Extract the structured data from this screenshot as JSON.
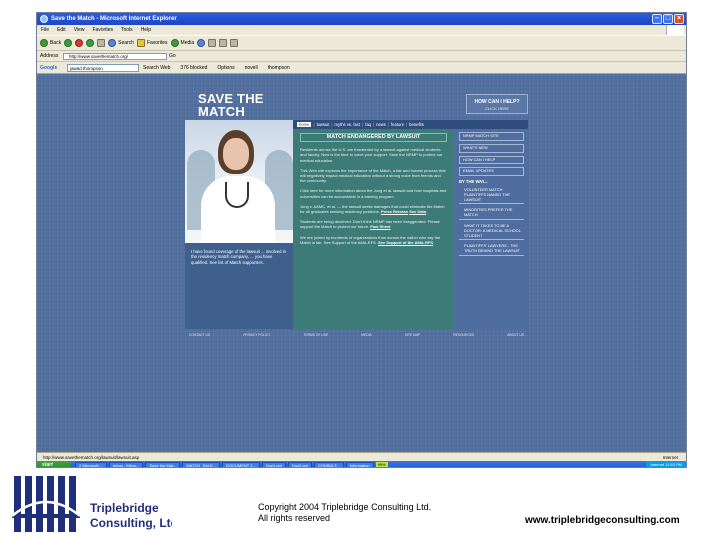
{
  "browser": {
    "window_title": "Save the Match - Microsoft Internet Explorer",
    "menu": [
      "File",
      "Edit",
      "View",
      "Favorites",
      "Tools",
      "Help"
    ],
    "toolbar": {
      "back": "Back",
      "search": "Search",
      "favorites": "Favorites",
      "media": "Media"
    },
    "address_label": "Address",
    "address_value": "http://www.savethematch.org/",
    "go_label": "Go",
    "google": {
      "logo": "Google",
      "query": "jawad thompson",
      "search_web": "Search Web",
      "blocked": "376 blocked",
      "options": "Options",
      "novell": "novell",
      "query_term": "thompson"
    },
    "status_text": "http://www.savethematch.org/lawsuit/lawsuit.asp",
    "zone_text": "Internet"
  },
  "site": {
    "title": "SAVE THE MATCH",
    "help_title": "HOW CAN I HELP?",
    "help_link": "CLICK HERE",
    "nav": [
      "home",
      "lawsuit",
      "myths vs. fact",
      "faq",
      "news",
      "feature",
      "benefits"
    ],
    "panel_title": "MATCH ENDANGERED BY LAWSUIT",
    "paragraphs": [
      "Residents across the U.S. are threatened by a lawsuit against medical students and faculty. Now is the time to voice your support. Save the NRMP to protect our medical education.",
      "This Web site explains the importance of the Match, a fair and honest process that will negatively impact medical education without a strong voice from friends and the community.",
      "Click here for more information about the Jung et al. lawsuit and how hospitals and universities can be accountable in a training program.",
      "Jung v. AAMC, et al. — the lawsuit seeks damages that could eliminate the Match for all graduates seeking residency positions.",
      "Students are being deceived. Don't think NRMP has been exaggerated. Please support the Match to protect our future.",
      "We are joined by hundreds of organizations from across the nation who say the Match is fair. See Support of the AMA-RFS."
    ],
    "panel_links": [
      "Press Release",
      "See Data",
      "Fact Sheet",
      "See Support of the AMA-RFS"
    ],
    "side_items": [
      "NRMP MATCH SITE",
      "WHAT'S NEW",
      "HOW CAN I HELP",
      "EMAIL UPDATES"
    ],
    "side_heading": "BY THE WAY...",
    "side_items2": [
      "VOLUNTEER MATCH PLAINTIFFS NAMED THE LAWSUIT",
      "MINORITIES PREFER THE MATCH",
      "WHAT IT TAKES TO BE A DOCTOR: A MEDICAL SCHOOL STUDENT",
      "PLAINTIFFS' LAWYERS - THE TRUTH BEHIND THE LAWSUIT"
    ],
    "left_caption": "I have found coverage of the lawsuit ... involved in the residency match company, ... you have qualified. See list of Match supporters.",
    "footer_links": [
      "CONTACT US",
      "PRIVACY POLICY",
      "TERMS OF USE",
      "MEDIA",
      "SITE MAP",
      "RESOURCES",
      "ABOUT US"
    ]
  },
  "taskbar": {
    "start": "start",
    "tasks": [
      "2 Microsoft ...",
      "Inbox - Micro...",
      "Save the Mat...",
      "MATCH_SALE...",
      "DOCUMENT 1...",
      "Doc1.ppt",
      "Doc2.ppt",
      "CONSULT...",
      "Information"
    ],
    "percent": "99%",
    "tray_text": "Internet",
    "clock": "11:53 PM"
  },
  "footer": {
    "company_line1": "Triplebridge",
    "company_line2": "Consulting, Ltd.",
    "copyright_line1": "Copyright 2004 Triplebridge Consulting Ltd.",
    "copyright_line2": "All rights reserved",
    "website": "www.triplebridgeconsulting.com"
  },
  "colors": {
    "logo_blue": "#1f2f7a",
    "site_bg": "#516d9b",
    "panel_teal": "#3d7b77"
  }
}
